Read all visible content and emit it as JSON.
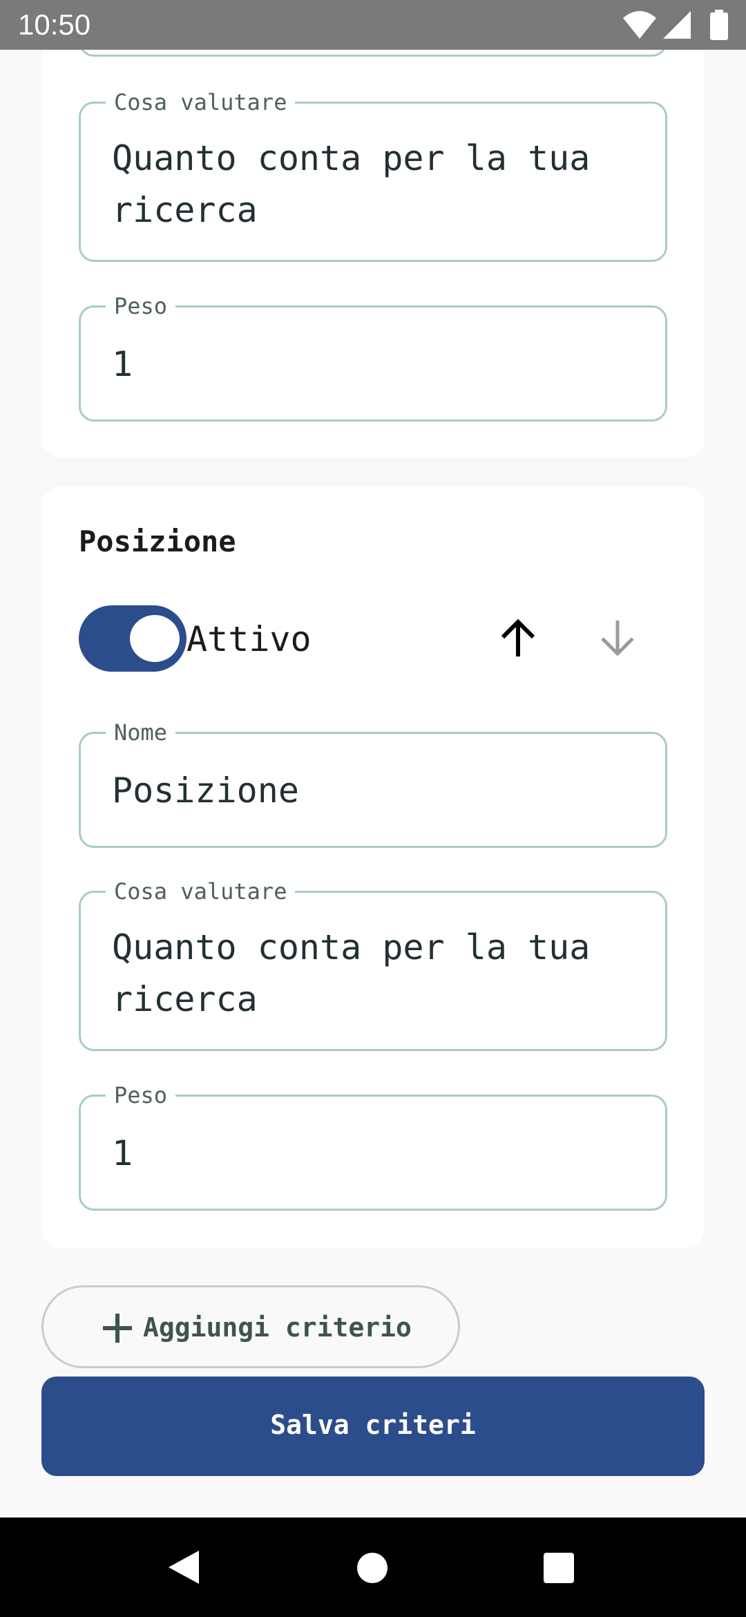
{
  "status_bar": {
    "time": "10:50",
    "icons": [
      "wifi-icon",
      "signal-icon",
      "battery-icon"
    ]
  },
  "criteria": [
    {
      "cosa_valutare_label": "Cosa valutare",
      "cosa_valutare_line1": "Quanto conta per la tua",
      "cosa_valutare_line2": "ricerca",
      "peso_label": "Peso",
      "peso_value": "1"
    },
    {
      "title": "Posizione",
      "toggle_label": "Attivo",
      "toggle_on": true,
      "nome_label": "Nome",
      "nome_value": "Posizione",
      "cosa_valutare_label": "Cosa valutare",
      "cosa_valutare_line1": "Quanto conta per la tua",
      "cosa_valutare_line2": "ricerca",
      "peso_label": "Peso",
      "peso_value": "1"
    }
  ],
  "actions": {
    "add_label": "Aggiungi criterio",
    "save_label": "Salva criteri"
  },
  "colors": {
    "primary": "#2c4d8b",
    "field_border": "#a9ccc4",
    "background": "#f9f9f9"
  },
  "nav_bar": {
    "icons": [
      "back-icon",
      "home-icon",
      "recents-icon"
    ]
  }
}
